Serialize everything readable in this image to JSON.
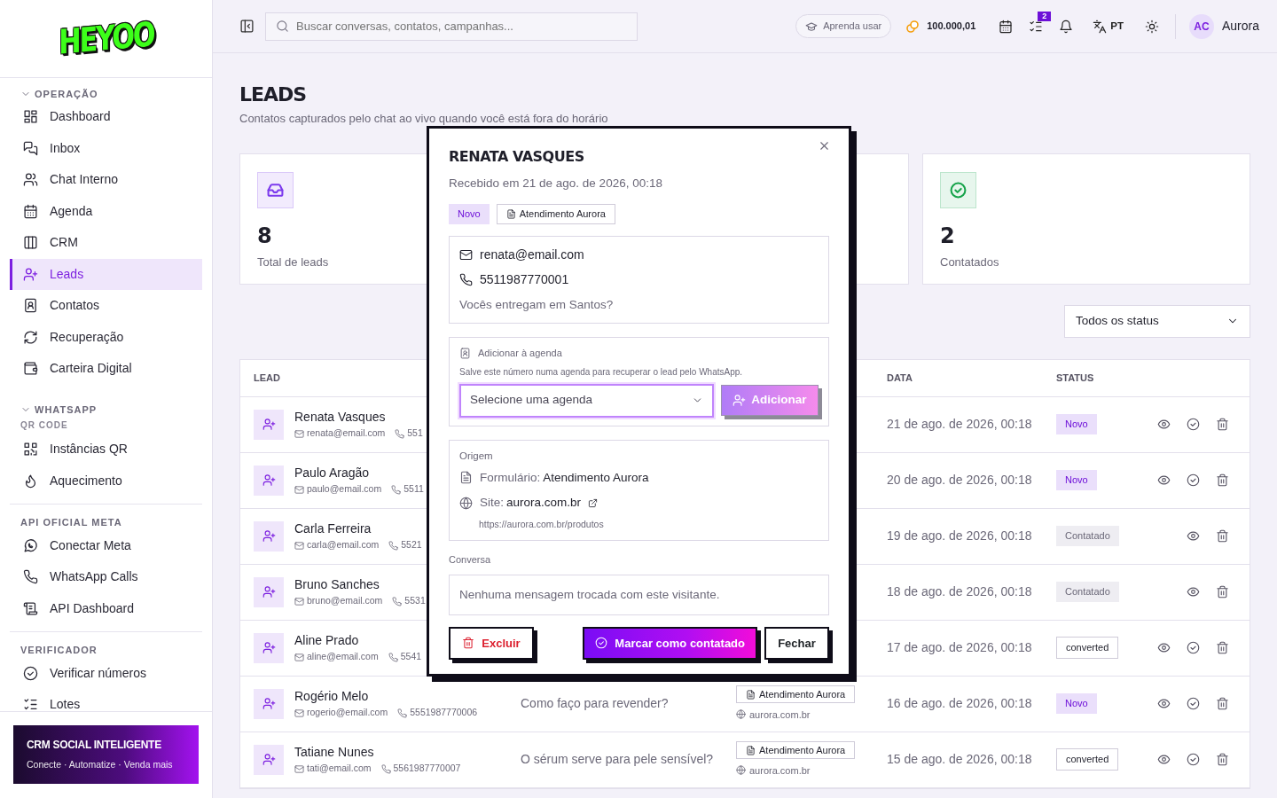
{
  "logo": "HEYOO",
  "sidebar": {
    "sections": [
      {
        "title": "OPERAÇÃO",
        "expanded": true,
        "items": [
          {
            "label": "Dashboard",
            "selected": false
          },
          {
            "label": "Inbox",
            "selected": false
          },
          {
            "label": "Chat Interno",
            "selected": false
          },
          {
            "label": "Agenda",
            "selected": false
          },
          {
            "label": "CRM",
            "selected": false
          },
          {
            "label": "Leads",
            "selected": true
          },
          {
            "label": "Contatos",
            "selected": false
          },
          {
            "label": "Recuperação",
            "selected": false
          },
          {
            "label": "Carteira Digital",
            "selected": false
          }
        ]
      },
      {
        "title": "WHATSAPP",
        "expanded": true,
        "subtitle": "QR CODE",
        "items": [
          {
            "label": "Instâncias QR",
            "selected": false
          },
          {
            "label": "Aquecimento",
            "selected": false
          }
        ]
      },
      {
        "title": "API OFICIAL META",
        "items": [
          {
            "label": "Conectar Meta",
            "selected": false
          },
          {
            "label": "WhatsApp Calls",
            "selected": false
          },
          {
            "label": "API Dashboard",
            "selected": false
          }
        ]
      },
      {
        "title": "VERIFICADOR",
        "items": [
          {
            "label": "Verificar números",
            "selected": false
          },
          {
            "label": "Lotes",
            "selected": false
          }
        ]
      }
    ],
    "promo": {
      "title": "CRM SOCIAL INTELIGENTE",
      "subtitle": "Conecte · Automatize · Venda mais"
    }
  },
  "topbar": {
    "search": {
      "placeholder": "Buscar conversas, contatos, campanhas..."
    },
    "learn": "Aprenda usar",
    "credits": "100.000,01",
    "tasks_badge": "2",
    "language": "PT",
    "avatar": "AC",
    "user": "Aurora"
  },
  "page": {
    "title": "LEADS",
    "subtitle": "Contatos capturados pelo chat ao vivo quando você está fora do horário"
  },
  "stats": [
    {
      "value": "8",
      "label": "Total de leads",
      "color": "#7c3aed"
    },
    {
      "value": "2",
      "label": "Contatados",
      "color": "#16a34a"
    }
  ],
  "filter": {
    "value": "Todos os status"
  },
  "table": {
    "columns": [
      {
        "label": "LEAD"
      },
      {
        "label": "DATA"
      },
      {
        "label": "STATUS"
      }
    ],
    "rows": [
      {
        "name": "Renata Vasques",
        "email": "renata@email.com",
        "phone": "551",
        "date": "21 de ago. de 2026, 00:18",
        "status": "Novo",
        "kind": "novo",
        "can_mark": true
      },
      {
        "name": "Paulo Aragão",
        "email": "paulo@email.com",
        "phone": "5511",
        "date": "20 de ago. de 2026, 00:18",
        "status": "Novo",
        "kind": "novo",
        "can_mark": true
      },
      {
        "name": "Carla Ferreira",
        "email": "carla@email.com",
        "phone": "5521",
        "date": "19 de ago. de 2026, 00:18",
        "status": "Contatado",
        "kind": "contatado",
        "can_mark": false
      },
      {
        "name": "Bruno Sanches",
        "email": "bruno@email.com",
        "phone": "5531",
        "date": "18 de ago. de 2026, 00:18",
        "status": "Contatado",
        "kind": "contatado",
        "can_mark": false
      },
      {
        "name": "Aline Prado",
        "email": "aline@email.com",
        "phone": "5541",
        "date": "17 de ago. de 2026, 00:18",
        "status": "converted",
        "kind": "converted",
        "can_mark": true
      },
      {
        "name": "Rogério Melo",
        "email": "rogerio@email.com",
        "phone": "5551987770006",
        "message": "Como faço para revender?",
        "form": "Atendimento Aurora",
        "site": "aurora.com.br",
        "date": "16 de ago. de 2026, 00:18",
        "status": "Novo",
        "kind": "novo",
        "can_mark": true
      },
      {
        "name": "Tatiane Nunes",
        "email": "tati@email.com",
        "phone": "5561987770007",
        "message": "O sérum serve para pele sensível?",
        "form": "Atendimento Aurora",
        "site": "aurora.com.br",
        "date": "15 de ago. de 2026, 00:18",
        "status": "converted",
        "kind": "converted",
        "can_mark": true
      }
    ]
  },
  "modal": {
    "title": "RENATA VASQUES",
    "received": "Recebido em 21 de ago. de 2026, 00:18",
    "status": {
      "label": "Novo",
      "kind": "novo"
    },
    "form_tag": "Atendimento Aurora",
    "email": "renata@email.com",
    "phone": "5511987770001",
    "message": "Vocês entregam em Santos?",
    "agenda": {
      "label": "Adicionar à agenda",
      "hint": "Salve este número numa agenda para recuperar o lead pelo WhatsApp.",
      "placeholder": "Selecione uma agenda",
      "button": "Adicionar"
    },
    "origin": {
      "label": "Origem",
      "form_label": "Formulário:",
      "form": "Atendimento Aurora",
      "site_label": "Site:",
      "site": "aurora.com.br",
      "url": "https://aurora.com.br/produtos"
    },
    "conversation": {
      "label": "Conversa",
      "empty": "Nenhuma mensagem trocada com este visitante."
    },
    "buttons": {
      "delete": "Excluir",
      "mark": "Marcar como contatado",
      "close": "Fechar"
    }
  }
}
